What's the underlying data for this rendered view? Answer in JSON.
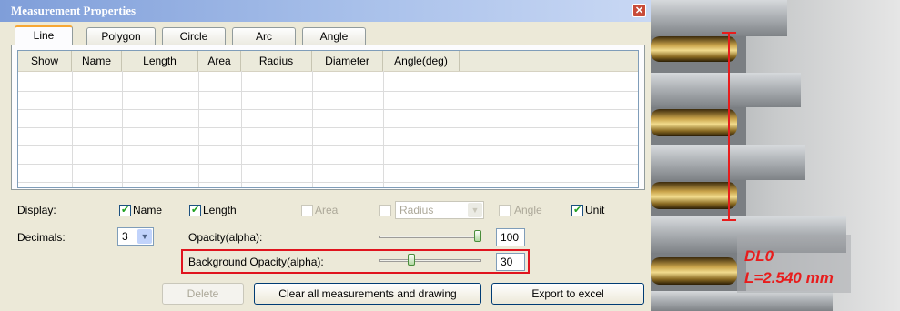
{
  "window": {
    "title": "Measurement Properties",
    "close_icon": "close-icon"
  },
  "tabs": [
    {
      "label": "Line",
      "active": true
    },
    {
      "label": "Polygon"
    },
    {
      "label": "Circle"
    },
    {
      "label": "Arc"
    },
    {
      "label": "Angle"
    }
  ],
  "table": {
    "columns": [
      "Show",
      "Name",
      "Length",
      "Area",
      "Radius",
      "Diameter",
      "Angle(deg)"
    ],
    "rows": []
  },
  "display": {
    "label": "Display:",
    "name": {
      "label": "Name",
      "checked": true
    },
    "length": {
      "label": "Length",
      "checked": true
    },
    "area": {
      "label": "Area",
      "checked": false,
      "disabled": true
    },
    "radius_select": {
      "value": "Radius",
      "checked": false,
      "disabled": true
    },
    "angle": {
      "label": "Angle",
      "checked": false,
      "disabled": true
    },
    "unit": {
      "label": "Unit",
      "checked": true
    }
  },
  "decimals": {
    "label": "Decimals:",
    "value": "3"
  },
  "opacity": {
    "label": "Opacity(alpha):",
    "value": "100",
    "level": 1.0
  },
  "bg_opacity": {
    "label": "Background Opacity(alpha):",
    "value": "30",
    "level": 0.3
  },
  "buttons": {
    "delete": "Delete",
    "clear": "Clear all measurements and drawing",
    "export": "Export to excel"
  },
  "image": {
    "measure_name": "DL0",
    "measure_value": "L=2.540 mm",
    "line_color": "#e81c1c"
  }
}
